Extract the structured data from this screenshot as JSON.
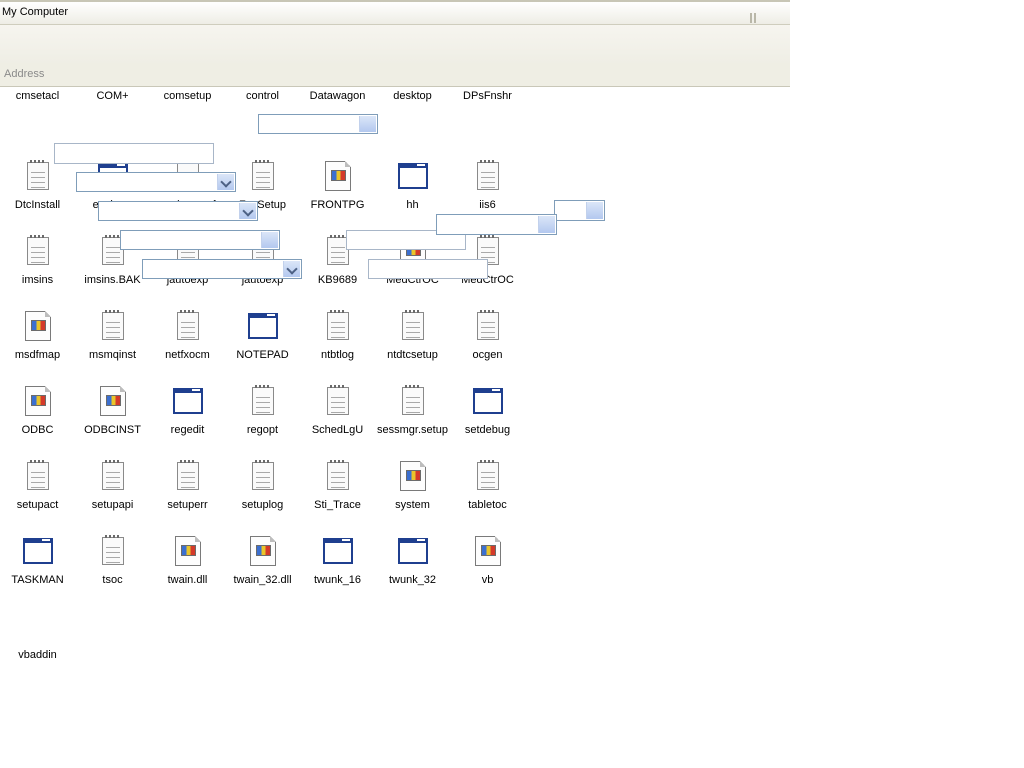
{
  "window": {
    "title": "My Computer"
  },
  "addressbar": {
    "label": "Address"
  },
  "files": [
    {
      "name": "cmsetacl",
      "icon": "none"
    },
    {
      "name": "COM+",
      "icon": "none"
    },
    {
      "name": "comsetup",
      "icon": "none"
    },
    {
      "name": "control",
      "icon": "none"
    },
    {
      "name": "Datawagon",
      "icon": "none"
    },
    {
      "name": "desktop",
      "icon": "none"
    },
    {
      "name": "DPsFnshr",
      "icon": "none"
    },
    {
      "name": "DtcInstall",
      "icon": "text-document-icon"
    },
    {
      "name": "explorer",
      "icon": "application-window-icon"
    },
    {
      "name": "explorer.scf",
      "icon": "text-document-icon"
    },
    {
      "name": "FaxSetup",
      "icon": "text-document-icon"
    },
    {
      "name": "FRONTPG",
      "icon": "settings-document-icon"
    },
    {
      "name": "hh",
      "icon": "application-window-icon"
    },
    {
      "name": "iis6",
      "icon": "text-document-icon"
    },
    {
      "name": "imsins",
      "icon": "text-document-icon"
    },
    {
      "name": "imsins.BAK",
      "icon": "text-document-icon"
    },
    {
      "name": "jautoexp",
      "icon": "text-document-icon"
    },
    {
      "name": "jautoexp",
      "icon": "text-document-icon"
    },
    {
      "name": "KB9689",
      "icon": "text-document-icon"
    },
    {
      "name": "MedCtrOC",
      "icon": "settings-document-icon"
    },
    {
      "name": "MedCtrOC",
      "icon": "text-document-icon"
    },
    {
      "name": "msdfmap",
      "icon": "settings-document-icon"
    },
    {
      "name": "msmqinst",
      "icon": "text-document-icon"
    },
    {
      "name": "netfxocm",
      "icon": "text-document-icon"
    },
    {
      "name": "NOTEPAD",
      "icon": "application-window-icon"
    },
    {
      "name": "ntbtlog",
      "icon": "text-document-icon"
    },
    {
      "name": "ntdtcsetup",
      "icon": "text-document-icon"
    },
    {
      "name": "ocgen",
      "icon": "text-document-icon"
    },
    {
      "name": "ODBC",
      "icon": "settings-document-icon"
    },
    {
      "name": "ODBCINST",
      "icon": "settings-document-icon"
    },
    {
      "name": "regedit",
      "icon": "application-window-icon"
    },
    {
      "name": "regopt",
      "icon": "text-document-icon"
    },
    {
      "name": "SchedLgU",
      "icon": "text-document-icon"
    },
    {
      "name": "sessmgr.setup",
      "icon": "text-document-icon"
    },
    {
      "name": "setdebug",
      "icon": "application-window-icon"
    },
    {
      "name": "setupact",
      "icon": "text-document-icon"
    },
    {
      "name": "setupapi",
      "icon": "text-document-icon"
    },
    {
      "name": "setuperr",
      "icon": "text-document-icon"
    },
    {
      "name": "setuplog",
      "icon": "text-document-icon"
    },
    {
      "name": "Sti_Trace",
      "icon": "text-document-icon"
    },
    {
      "name": "system",
      "icon": "settings-document-icon"
    },
    {
      "name": "tabletoc",
      "icon": "text-document-icon"
    },
    {
      "name": "TASKMAN",
      "icon": "application-window-icon"
    },
    {
      "name": "tsoc",
      "icon": "text-document-icon"
    },
    {
      "name": "twain.dll",
      "icon": "settings-document-icon"
    },
    {
      "name": "twain_32.dll",
      "icon": "settings-document-icon"
    },
    {
      "name": "twunk_16",
      "icon": "application-window-icon"
    },
    {
      "name": "twunk_32",
      "icon": "application-window-icon"
    },
    {
      "name": "vb",
      "icon": "settings-document-icon"
    },
    {
      "name": "vbaddin",
      "icon": "none"
    }
  ],
  "overlays": [
    {
      "name": "overlay-spinbox-1",
      "kind": "button"
    },
    {
      "name": "overlay-textbox-1",
      "kind": "text"
    },
    {
      "name": "overlay-dropdown-1",
      "kind": "dropdown"
    },
    {
      "name": "overlay-dropdown-2",
      "kind": "dropdown"
    },
    {
      "name": "overlay-spinbox-2",
      "kind": "button"
    },
    {
      "name": "overlay-textbox-2",
      "kind": "text"
    },
    {
      "name": "overlay-spinbox-3",
      "kind": "button"
    },
    {
      "name": "overlay-spinbox-4",
      "kind": "button"
    },
    {
      "name": "overlay-dropdown-3",
      "kind": "dropdown"
    },
    {
      "name": "overlay-textbox-3",
      "kind": "text"
    }
  ]
}
